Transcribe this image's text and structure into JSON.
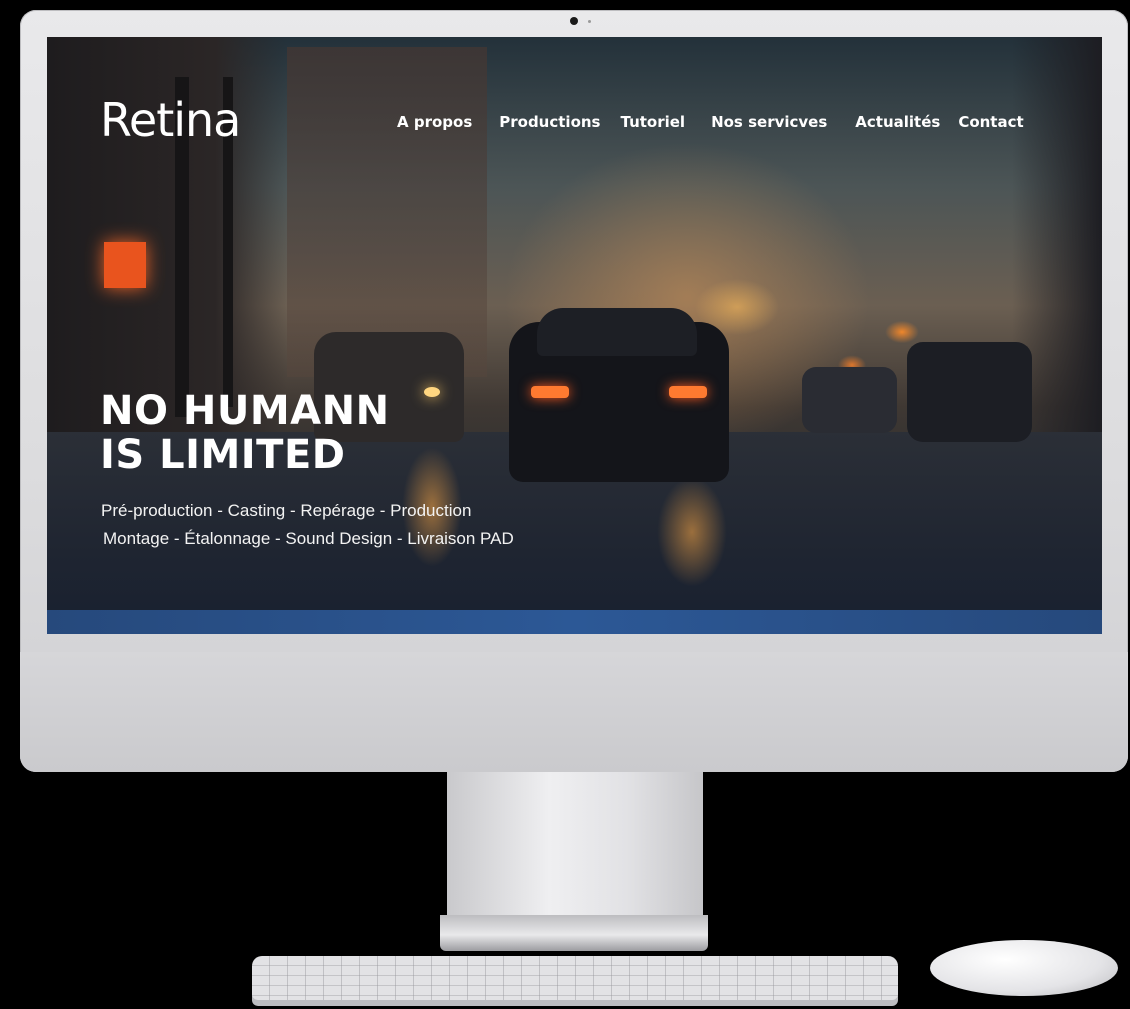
{
  "site": {
    "logo": "Retina",
    "nav": [
      {
        "label": "A propos"
      },
      {
        "label": "Productions"
      },
      {
        "label": "Tutoriel"
      },
      {
        "label": "Nos servicves"
      },
      {
        "label": "Actualités"
      },
      {
        "label": "Contact"
      }
    ],
    "hero": {
      "title_line1": "NO HUMANN",
      "title_line2": "IS LIMITED",
      "services_line1": "Pré-production -  Casting - Repérage - Production",
      "services_line2": "Montage - Étalonnage  - Sound Design  - Livraison PAD"
    }
  },
  "colors": {
    "accent_stripe": "#2c5896",
    "text": "#ffffff"
  }
}
